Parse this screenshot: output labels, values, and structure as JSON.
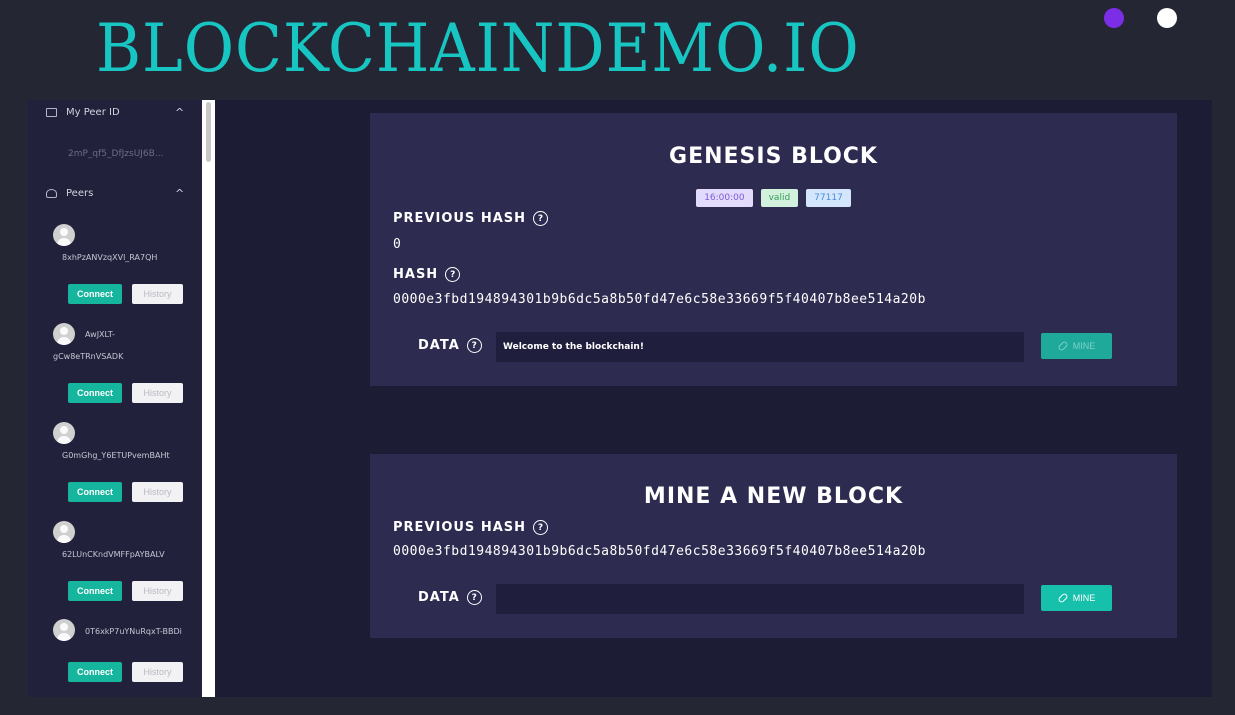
{
  "site": {
    "title": "BLOCKCHAINDEMO.IO",
    "theme_dots": [
      "purple",
      "white"
    ]
  },
  "sidebar": {
    "my_peer_id": {
      "label": "My Peer ID",
      "value": "2mP_qf5_DfJzsUJ6B..."
    },
    "peers": {
      "label": "Peers",
      "connect_label": "Connect",
      "history_label": "History",
      "items": [
        {
          "name": "8xhPzANVzqXVl_RA7QH"
        },
        {
          "name_line1": "AwJXLT-",
          "name_line2": "gCw8eTRnVSADK"
        },
        {
          "name": "G0mGhg_Y6ETUPvemBAHt"
        },
        {
          "name": "62LUnCKndVMFFpAYBALV"
        },
        {
          "name": "0T6xkP7uYNuRqxT-BBDi"
        }
      ]
    }
  },
  "genesis_block": {
    "title": "GENESIS BLOCK",
    "badges": {
      "time": "16:00:00",
      "status": "valid",
      "nonce": "77117"
    },
    "previous_hash_label": "PREVIOUS HASH",
    "previous_hash": "0",
    "hash_label": "HASH",
    "hash": "0000e3fbd194894301b9b6dc5a8b50fd47e6c58e33669f5f40407b8ee514a20b",
    "data_label": "DATA",
    "data_value": "Welcome to the blockchain!",
    "mine_label": "MINE"
  },
  "new_block": {
    "title": "MINE A NEW BLOCK",
    "previous_hash_label": "PREVIOUS HASH",
    "previous_hash": "0000e3fbd194894301b9b6dc5a8b50fd47e6c58e33669f5f40407b8ee514a20b",
    "data_label": "DATA",
    "data_value": "",
    "mine_label": "MINE"
  },
  "colors": {
    "accent_teal": "#17c6c2",
    "button_teal": "#17c0ab",
    "card_bg": "#2d2b50",
    "theme_purple": "#7b2ee6"
  }
}
